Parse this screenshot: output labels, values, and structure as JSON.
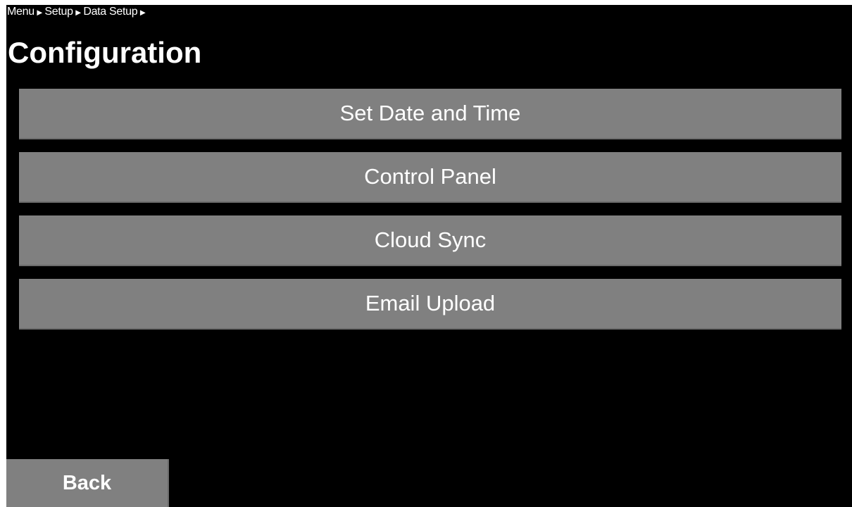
{
  "breadcrumb": {
    "items": [
      "Menu",
      "Setup",
      "Data Setup"
    ],
    "separator": "►"
  },
  "page": {
    "title": "Configuration"
  },
  "menu": {
    "items": [
      {
        "label": "Set Date and Time"
      },
      {
        "label": "Control Panel"
      },
      {
        "label": "Cloud Sync"
      },
      {
        "label": "Email Upload"
      }
    ]
  },
  "footer": {
    "back_label": "Back"
  },
  "colors": {
    "background": "#000000",
    "button": "#808080",
    "text": "#ffffff"
  }
}
